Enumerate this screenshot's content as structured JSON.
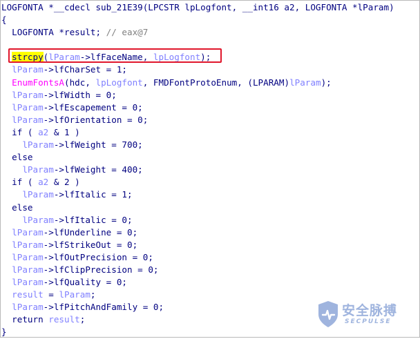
{
  "code": {
    "signature": "LOGFONTA *__cdecl sub_21E39(LPCSTR lpLogfont, __int16 a2, LOGFONTA *lParam)",
    "open_brace": "{",
    "close_brace": "}",
    "decl": {
      "type": "LOGFONTA *",
      "var": "result",
      "semi": ";",
      "comment": " // eax@7"
    },
    "strcpy_line": {
      "func": "strcpy",
      "arg1": "lParam",
      "arg1_member": "->lfFaceName, ",
      "arg2": "lpLogfont",
      "end": ");"
    },
    "lines": {
      "charset_var": "lParam",
      "charset_rest": "->lfCharSet = 1;",
      "enum_func": "EnumFontsA",
      "enum_a": "(hdc, ",
      "enum_b": "lpLogfont",
      "enum_c": ", FMDFontProtoEnum, (LPARAM)",
      "enum_d": "lParam",
      "enum_e": ");",
      "width_var": "lParam",
      "width_rest": "->lfWidth = 0;",
      "esc_var": "lParam",
      "esc_rest": "->lfEscapement = 0;",
      "orient_var": "lParam",
      "orient_rest": "->lfOrientation = 0;",
      "if1_a": "if ( ",
      "if1_var": "a2",
      "if1_b": " & 1 )",
      "weight700_var": "lParam",
      "weight700_rest": "->lfWeight = 700;",
      "else1": "else",
      "weight400_var": "lParam",
      "weight400_rest": "->lfWeight = 400;",
      "if2_a": "if ( ",
      "if2_var": "a2",
      "if2_b": " & 2 )",
      "italic1_var": "lParam",
      "italic1_rest": "->lfItalic = 1;",
      "else2": "else",
      "italic0_var": "lParam",
      "italic0_rest": "->lfItalic = 0;",
      "under_var": "lParam",
      "under_rest": "->lfUnderline = 0;",
      "strike_var": "lParam",
      "strike_rest": "->lfStrikeOut = 0;",
      "outp_var": "lParam",
      "outp_rest": "->lfOutPrecision = 0;",
      "clip_var": "lParam",
      "clip_rest": "->lfClipPrecision = 0;",
      "qual_var": "lParam",
      "qual_rest": "->lfQuality = 0;",
      "res_var": "result",
      "res_eq": " = ",
      "res_val": "lParam",
      "res_end": ";",
      "pitch_var": "lParam",
      "pitch_rest": "->lfPitchAndFamily = 0;",
      "ret_kw": "return ",
      "ret_var": "result",
      "ret_end": ";"
    }
  },
  "watermark": {
    "cn": "安全脉搏",
    "en": "SECPULSE",
    "color": "#7f9bd4",
    "icon": "shield-icon"
  },
  "colors": {
    "highlight": "#ffff00",
    "box": "#e0162b"
  }
}
